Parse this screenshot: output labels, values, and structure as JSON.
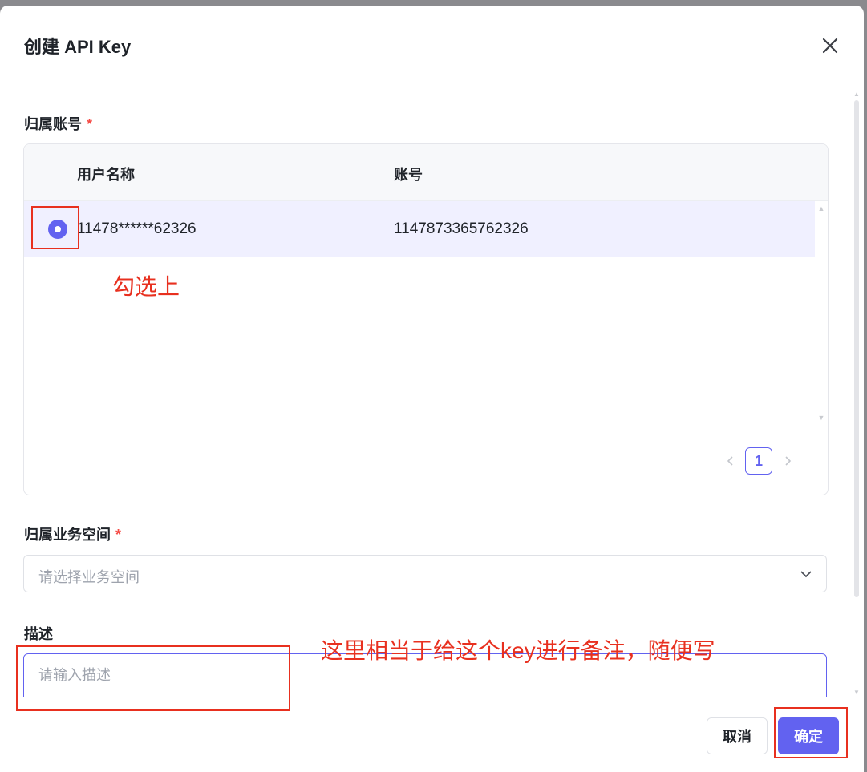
{
  "dialog": {
    "title": "创建 API Key",
    "close_icon": "close-icon"
  },
  "form": {
    "account": {
      "label": "归属账号",
      "required_mark": "*",
      "table": {
        "columns": [
          "用户名称",
          "账号"
        ],
        "rows": [
          {
            "selected": true,
            "username": "11478******62326",
            "account": "1147873365762326"
          }
        ],
        "pagination": {
          "current_page": "1"
        }
      }
    },
    "workspace": {
      "label": "归属业务空间",
      "required_mark": "*",
      "placeholder": "请选择业务空间"
    },
    "description": {
      "label": "描述",
      "placeholder": "请输入描述"
    }
  },
  "footer": {
    "cancel_label": "取消",
    "ok_label": "确定"
  },
  "annotations": {
    "select_note": "勾选上",
    "desc_note": "这里相当于给这个key进行备注，随便写"
  },
  "colors": {
    "primary": "#6262f0",
    "annotation": "#e8301f",
    "required": "#f54a45"
  }
}
